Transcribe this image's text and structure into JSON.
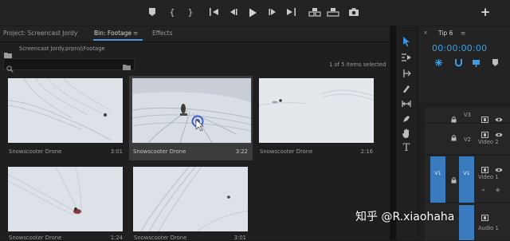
{
  "app": {
    "add_button": "+"
  },
  "transport": {
    "marker_icon": "marker-icon",
    "in_label": "{",
    "out_label": "}",
    "goto_in_icon": "goto-in-icon",
    "step_back_icon": "step-back-icon",
    "play_icon": "play-icon",
    "step_forward_icon": "step-forward-icon",
    "goto_out_icon": "goto-out-icon",
    "insert_icon": "insert-icon",
    "overwrite_icon": "overwrite-icon",
    "export_frame_icon": "camera-icon"
  },
  "project_panel": {
    "tabs": [
      {
        "label": "Project: Screencast Jordy"
      },
      {
        "label": "Bin: Footage"
      },
      {
        "label": "Effects"
      }
    ],
    "menu_icon": "≡",
    "path": "Screencast Jordy.prproj\\Footage",
    "items_selected": "1 of 5 items selected",
    "search_placeholder": ""
  },
  "clips": [
    {
      "name": "Snowscooter Drone",
      "duration": "3:01"
    },
    {
      "name": "Snowscooter Drone",
      "duration": "3:22"
    },
    {
      "name": "Snowscooter Drone",
      "duration": "2:16"
    },
    {
      "name": "Snowscooter Drone",
      "duration": "1:24"
    },
    {
      "name": "Snowscooter Drone",
      "duration": "3:01"
    }
  ],
  "timeline": {
    "tab_label": "Tip 6",
    "menu_icon": "≡",
    "timecode": "00:00:00:00",
    "accent_color": "#3a9fe6",
    "tracks": [
      {
        "label": "V3",
        "name": ""
      },
      {
        "label": "V2",
        "name": "Video 2"
      },
      {
        "label": "V1",
        "name": "Video 1",
        "source": "V1"
      },
      {
        "label": "A1",
        "name": "Audio 1"
      }
    ]
  },
  "watermark": "知乎 @R.xiaohaha"
}
